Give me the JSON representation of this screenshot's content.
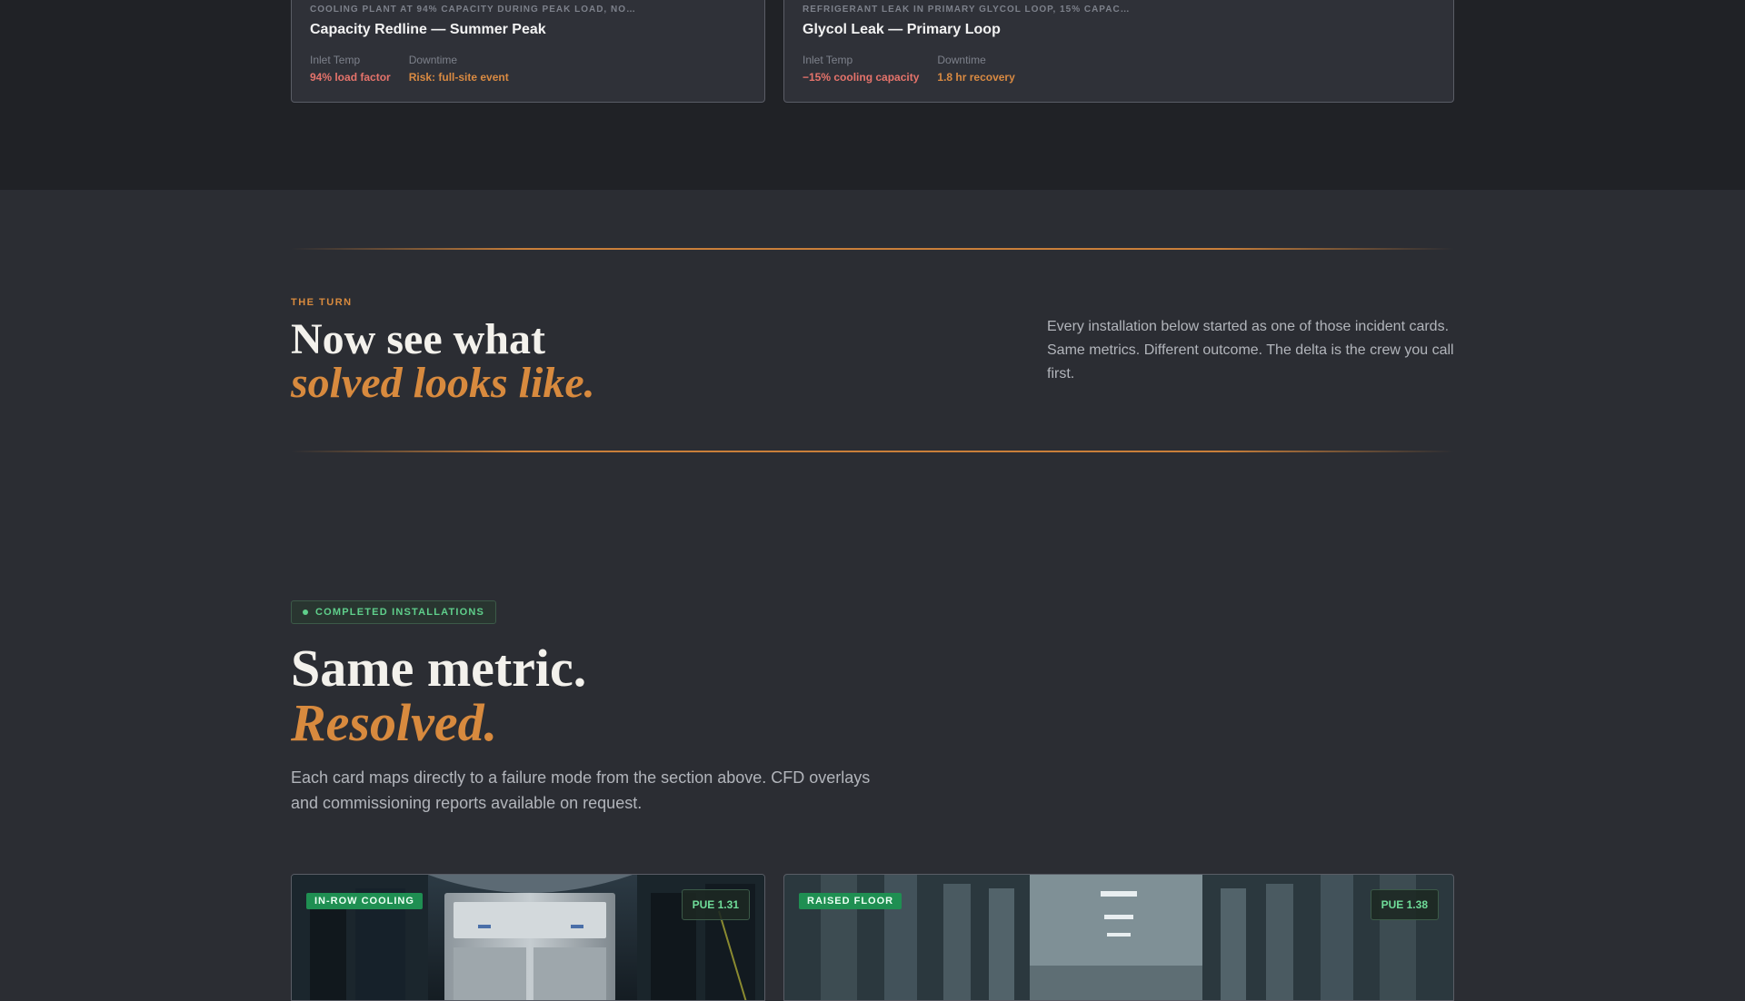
{
  "incidents": [
    {
      "eyebrow": "COOLING PLANT AT 94% CAPACITY DURING PEAK LOAD, NO…",
      "title": "Capacity Redline — Summer Peak",
      "metric1_label": "Inlet Temp",
      "metric1_value": "94% load factor",
      "metric2_label": "Downtime",
      "metric2_value": "Risk: full-site event"
    },
    {
      "eyebrow": "REFRIGERANT LEAK IN PRIMARY GLYCOL LOOP, 15% CAPAC…",
      "title": "Glycol Leak — Primary Loop",
      "metric1_label": "Inlet Temp",
      "metric1_value": "−15% cooling capacity",
      "metric2_label": "Downtime",
      "metric2_value": "1.8 hr recovery"
    }
  ],
  "turn": {
    "eyebrow": "THE TURN",
    "heading_line1": "Now see what",
    "heading_line2": "solved looks like.",
    "body": "Every installation below started as one of those incident cards. Same metrics. Different outcome. The delta is the crew you call first."
  },
  "installations": {
    "badge": "COMPLETED INSTALLATIONS",
    "heading_line1": "Same metric.",
    "heading_line2": "Resolved.",
    "body": "Each card maps directly to a failure mode from the section above. CFD overlays and commissioning reports available on request.",
    "cards": [
      {
        "tag": "IN-ROW COOLING",
        "pue": "PUE 1.31"
      },
      {
        "tag": "RAISED FLOOR",
        "pue": "PUE 1.38"
      }
    ]
  },
  "colors": {
    "accent": "#d88a3e",
    "success": "#5fcf8b",
    "danger": "#e5736b",
    "background": "#2b2d33"
  }
}
